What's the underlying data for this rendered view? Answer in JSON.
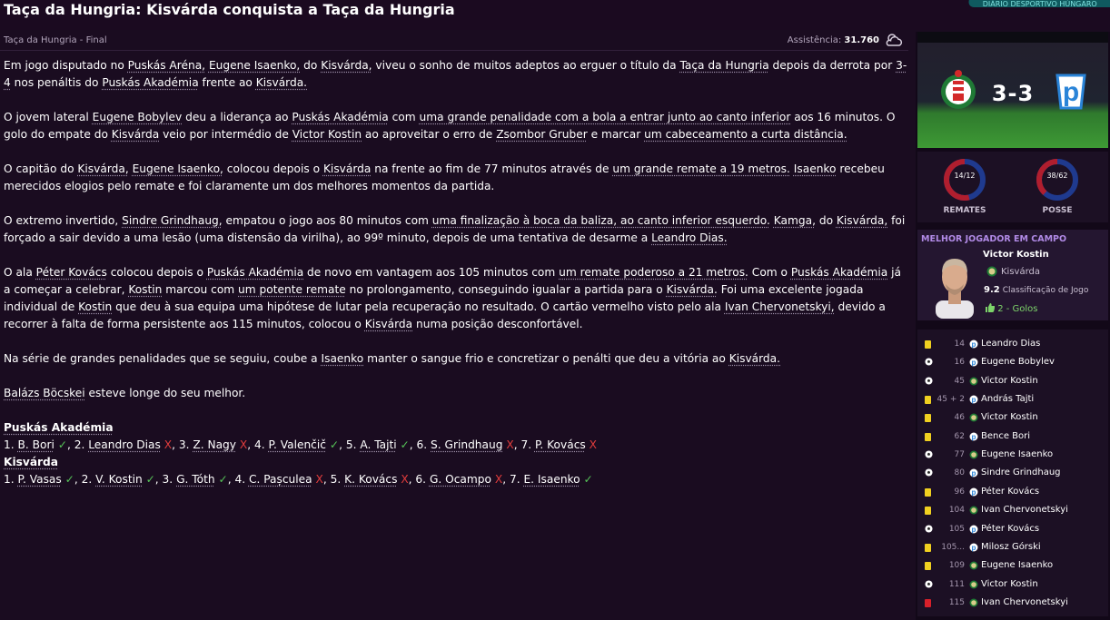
{
  "header": {
    "title": "Taça da Hungria: Kisvárda conquista a Taça da Hungria",
    "tag": "DIÁRIO DESPORTIVO HÚNGARO"
  },
  "subheader": {
    "competition": "Taça da Hungria - Final",
    "attendance_label": "Assistência:",
    "attendance_value": "31.760",
    "weather_icon": "cloudy-weather-icon"
  },
  "article": {
    "paragraphs": [
      {
        "id": "p1",
        "segments": [
          {
            "t": "Em jogo disputado no "
          },
          {
            "t": "Puskás Aréna,",
            "u": true
          },
          {
            "t": " "
          },
          {
            "t": "Eugene Isaenko,",
            "u": true
          },
          {
            "t": " do "
          },
          {
            "t": "Kisvárda,",
            "u": true
          },
          {
            "t": " viveu o sonho de muitos adeptos ao erguer o título da "
          },
          {
            "t": "Taça da Hungria",
            "u": true
          },
          {
            "t": " depois da derrota por "
          },
          {
            "t": "3-4",
            "u": true
          },
          {
            "t": " nos penáltis do "
          },
          {
            "t": "Puskás Akadémia",
            "u": true
          },
          {
            "t": " frente ao "
          },
          {
            "t": "Kisvárda.",
            "u": true
          }
        ]
      },
      {
        "id": "p2",
        "segments": [
          {
            "t": "O jovem lateral "
          },
          {
            "t": "Eugene Bobylev",
            "u": true
          },
          {
            "t": " deu a liderança ao "
          },
          {
            "t": "Puskás Akadémia",
            "u": true
          },
          {
            "t": " com "
          },
          {
            "t": "uma grande penalidade com a bola a entrar junto ao canto inferior",
            "u": true
          },
          {
            "t": " aos 16 minutos. O golo do empate do "
          },
          {
            "t": "Kisvárda",
            "u": true
          },
          {
            "t": " veio por intermédio de "
          },
          {
            "t": "Victor Kostin",
            "u": true
          },
          {
            "t": " ao aproveitar o erro de "
          },
          {
            "t": "Zsombor Gruber",
            "u": true
          },
          {
            "t": " e marcar "
          },
          {
            "t": "um cabeceamento a curta distância.",
            "u": true
          }
        ]
      },
      {
        "id": "p3",
        "segments": [
          {
            "t": "O capitão do "
          },
          {
            "t": "Kisvárda,",
            "u": true
          },
          {
            "t": " "
          },
          {
            "t": "Eugene Isaenko,",
            "u": true
          },
          {
            "t": " colocou depois o "
          },
          {
            "t": "Kisvárda",
            "u": true
          },
          {
            "t": " na frente ao fim de 77 minutos através de "
          },
          {
            "t": "um grande remate a 19 metros.",
            "u": true
          },
          {
            "t": " "
          },
          {
            "t": "Isaenko",
            "u": true
          },
          {
            "t": " recebeu merecidos elogios pelo remate e foi claramente um dos melhores momentos da partida."
          }
        ]
      },
      {
        "id": "p4",
        "segments": [
          {
            "t": "O extremo invertido, "
          },
          {
            "t": "Sindre Grindhaug,",
            "u": true
          },
          {
            "t": " empatou o jogo aos 80 minutos com "
          },
          {
            "t": "uma finalização à boca da baliza, ao canto inferior esquerdo.",
            "u": true
          },
          {
            "t": " "
          },
          {
            "t": "Kamga,",
            "u": true
          },
          {
            "t": " do "
          },
          {
            "t": "Kisvárda,",
            "u": true
          },
          {
            "t": " foi forçado a sair devido a uma lesão (uma distensão da virilha), ao 99º minuto, depois de uma tentativa de desarme a "
          },
          {
            "t": "Leandro Dias.",
            "u": true
          }
        ]
      },
      {
        "id": "p5",
        "segments": [
          {
            "t": "O ala "
          },
          {
            "t": "Péter Kovács",
            "u": true
          },
          {
            "t": " colocou depois o "
          },
          {
            "t": "Puskás Akadémia",
            "u": true
          },
          {
            "t": " de novo em vantagem aos 105 minutos com "
          },
          {
            "t": "um remate poderoso a 21 metros.",
            "u": true
          },
          {
            "t": " Com o "
          },
          {
            "t": "Puskás Akadémia",
            "u": true
          },
          {
            "t": " já a começar a celebrar, "
          },
          {
            "t": "Kostin",
            "u": true
          },
          {
            "t": " marcou com "
          },
          {
            "t": "um potente remate",
            "u": true
          },
          {
            "t": " no prolongamento, conseguindo igualar a partida para o "
          },
          {
            "t": "Kisvárda.",
            "u": true
          },
          {
            "t": " Foi uma excelente jogada individual de "
          },
          {
            "t": "Kostin",
            "u": true
          },
          {
            "t": " que deu à sua equipa uma hipótese de lutar pela recuperação no resultado. O cartão vermelho visto pelo ala "
          },
          {
            "t": "Ivan Chervonetskyi,",
            "u": true
          },
          {
            "t": " devido a recorrer à falta de forma persistente aos 115 minutos, colocou o "
          },
          {
            "t": "Kisvárda",
            "u": true
          },
          {
            "t": " numa posição desconfortável."
          }
        ]
      },
      {
        "id": "p6",
        "segments": [
          {
            "t": "Na série de grandes penalidades que se seguiu, coube a "
          },
          {
            "t": "Isaenko",
            "u": true
          },
          {
            "t": " manter o sangue frio e concretizar o penálti que deu a vitória ao "
          },
          {
            "t": "Kisvárda.",
            "u": true
          }
        ]
      },
      {
        "id": "p7",
        "segments": [
          {
            "t": "Balázs Böcskei",
            "u": true
          },
          {
            "t": " esteve longe do seu melhor."
          }
        ]
      }
    ],
    "penalties": [
      {
        "team": "Puskás Akadémia",
        "kicks": [
          {
            "n": "1.",
            "name": "B. Bori",
            "scored": true
          },
          {
            "n": "2.",
            "name": "Leandro Dias",
            "scored": false
          },
          {
            "n": "3.",
            "name": "Z. Nagy",
            "scored": false
          },
          {
            "n": "4.",
            "name": "P. Valenčič",
            "scored": true
          },
          {
            "n": "5.",
            "name": "A. Tajti",
            "scored": true
          },
          {
            "n": "6.",
            "name": "S. Grindhaug",
            "scored": false
          },
          {
            "n": "7.",
            "name": "P. Kovács",
            "scored": false
          }
        ]
      },
      {
        "team": "Kisvárda",
        "kicks": [
          {
            "n": "1.",
            "name": "P. Vasas",
            "scored": true
          },
          {
            "n": "2.",
            "name": "V. Kostin",
            "scored": true
          },
          {
            "n": "3.",
            "name": "G. Tóth",
            "scored": true
          },
          {
            "n": "4.",
            "name": "C. Pașculea",
            "scored": false
          },
          {
            "n": "5.",
            "name": "K. Kovács",
            "scored": false
          },
          {
            "n": "6.",
            "name": "G. Ocampo",
            "scored": false
          },
          {
            "n": "7.",
            "name": "E. Isaenko",
            "scored": true
          }
        ]
      }
    ],
    "ok_mark": "✓",
    "miss_mark": "X"
  },
  "scorebox": {
    "score": "3-3",
    "home_crest": "kisvarda-crest-icon",
    "away_crest": "puskas-crest-icon"
  },
  "stats": [
    {
      "id": "shots",
      "label": "REMATES",
      "value": "14/12",
      "home_fraction": 0.538,
      "home_color": "#b01e2e",
      "away_color": "#1f3a8f"
    },
    {
      "id": "possession",
      "label": "POSSE",
      "value": "38/62",
      "home_fraction": 0.38,
      "home_color": "#b01e2e",
      "away_color": "#1f3a8f"
    }
  ],
  "motm": {
    "title": "MELHOR JOGADOR EM CAMPO",
    "name": "Victor Kostin",
    "club": "Kisvárda",
    "rating": "9.2",
    "rating_label": "Classificação de Jogo",
    "goals": "2 - Golos"
  },
  "events": [
    {
      "type": "yellow",
      "min": "14",
      "club": "pus",
      "name": "Leandro Dias"
    },
    {
      "type": "goal",
      "min": "16",
      "club": "pus",
      "name": "Eugene Bobylev"
    },
    {
      "type": "goal",
      "min": "45",
      "club": "kis",
      "name": "Victor Kostin"
    },
    {
      "type": "yellow",
      "min": "45 + 2",
      "club": "pus",
      "name": "András Tajti"
    },
    {
      "type": "yellow",
      "min": "46",
      "club": "kis",
      "name": "Victor Kostin"
    },
    {
      "type": "yellow",
      "min": "62",
      "club": "pus",
      "name": "Bence Bori"
    },
    {
      "type": "goal",
      "min": "77",
      "club": "kis",
      "name": "Eugene Isaenko"
    },
    {
      "type": "goal",
      "min": "80",
      "club": "pus",
      "name": "Sindre Grindhaug"
    },
    {
      "type": "yellow",
      "min": "96",
      "club": "pus",
      "name": "Péter Kovács"
    },
    {
      "type": "yellow",
      "min": "104",
      "club": "kis",
      "name": "Ivan Chervonetskyi"
    },
    {
      "type": "goal",
      "min": "105",
      "club": "pus",
      "name": "Péter Kovács"
    },
    {
      "type": "yellow",
      "min": "105...",
      "club": "pus",
      "name": "Milosz Górski"
    },
    {
      "type": "yellow",
      "min": "109",
      "club": "kis",
      "name": "Eugene Isaenko"
    },
    {
      "type": "goal",
      "min": "111",
      "club": "kis",
      "name": "Victor Kostin"
    },
    {
      "type": "red",
      "min": "115",
      "club": "kis",
      "name": "Ivan Chervonetskyi"
    }
  ],
  "colors": {
    "background": "#1a0c20",
    "yellow_card": "#f0d020",
    "red_card": "#d8202a",
    "ok": "#55c257",
    "miss": "#e03c3c",
    "motm_title": "#b18ae6"
  }
}
